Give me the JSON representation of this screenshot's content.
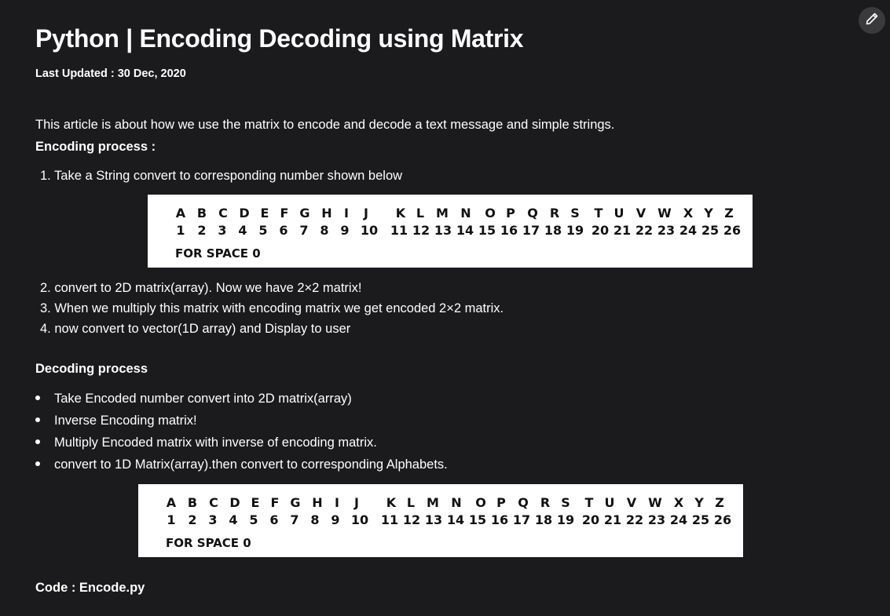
{
  "header": {
    "title": "Python | Encoding Decoding using Matrix",
    "last_updated": "Last Updated : 30 Dec, 2020",
    "edit_icon": "pencil-icon"
  },
  "article": {
    "intro": "This article is about how we use the matrix to encode and decode a text message and simple strings.",
    "encoding_heading": "Encoding process :",
    "encoding_steps": [
      "1. Take a String convert to corresponding number shown below",
      "2. convert to 2D matrix(array). Now we have 2×2 matrix!",
      "3. When we multiply this matrix with encoding matrix we get encoded 2×2 matrix.",
      "4. now convert to vector(1D array) and Display to user"
    ],
    "decoding_heading": "Decoding process",
    "decoding_steps": [
      "Take Encoded number convert into 2D matrix(array)",
      "Inverse Encoding matrix!",
      "Multiply Encoded matrix with inverse of encoding matrix.",
      "convert to 1D Matrix(array).then convert to corresponding Alphabets."
    ],
    "code_heading": "Code : Encode.py"
  },
  "alphabet_table": {
    "letters": [
      "A",
      "B",
      "C",
      "D",
      "E",
      "F",
      "G",
      "H",
      "I",
      "J",
      "K",
      "L",
      "M",
      "N",
      "O",
      "P",
      "Q",
      "R",
      "S",
      "T",
      "U",
      "V",
      "W",
      "X",
      "Y",
      "Z"
    ],
    "numbers": [
      "1",
      "2",
      "3",
      "4",
      "5",
      "6",
      "7",
      "8",
      "9",
      "10",
      "11",
      "12",
      "13",
      "14",
      "15",
      "16",
      "17",
      "18",
      "19",
      "20",
      "21",
      "22",
      "23",
      "24",
      "25",
      "26"
    ],
    "space_note": "FOR SPACE 0"
  }
}
